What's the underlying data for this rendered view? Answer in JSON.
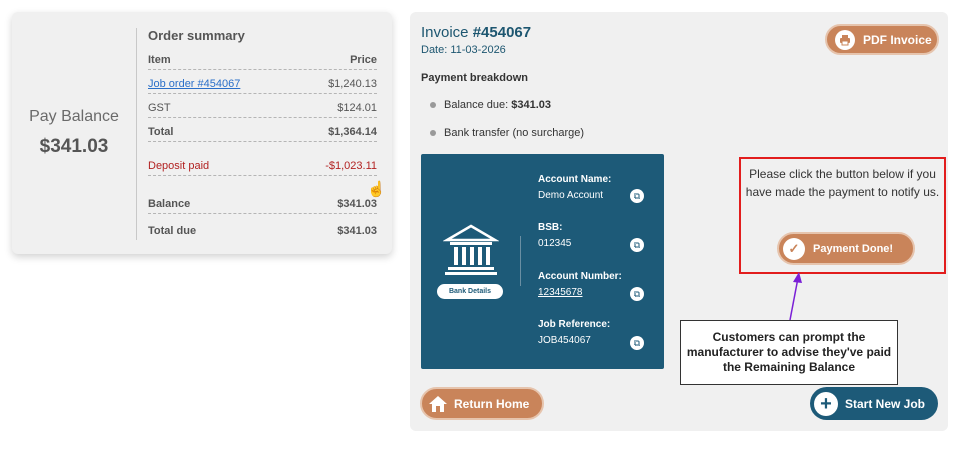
{
  "pay_balance": {
    "label": "Pay Balance",
    "amount": "$341.03"
  },
  "order_summary": {
    "title": "Order summary",
    "col_item": "Item",
    "col_price": "Price",
    "rows": [
      {
        "item": "Job order #454067",
        "price": "$1,240.13"
      },
      {
        "item": "GST",
        "price": "$124.01"
      },
      {
        "item": "Total",
        "price": "$1,364.14"
      },
      {
        "item": "Deposit paid",
        "price": "-$1,023.11"
      },
      {
        "item": "Balance",
        "price": "$341.03"
      },
      {
        "item": "Total due",
        "price": "$341.03"
      }
    ]
  },
  "invoice": {
    "title_prefix": "Invoice",
    "number": "#454067",
    "date": "Date: 11-03-2026",
    "pdf_label": "PDF Invoice"
  },
  "breakdown": {
    "title": "Payment breakdown",
    "balance_label": "Balance due:",
    "balance_value": "$341.03",
    "transfer": "Bank transfer (no surcharge)"
  },
  "bank": {
    "badge": "Bank Details",
    "fields": [
      {
        "label": "Account Name:",
        "value": "Demo Account"
      },
      {
        "label": "BSB:",
        "value": "012345"
      },
      {
        "label": "Account Number:",
        "value": "12345678"
      },
      {
        "label": "Job Reference:",
        "value": "JOB454067"
      }
    ]
  },
  "notify": {
    "text": "Please click the button below if you have made the payment to notify us.",
    "button": "Payment Done!"
  },
  "callout": "Customers can prompt the manufacturer to advise they've paid the Remaining Balance",
  "buttons": {
    "return_home": "Return Home",
    "start_new_job": "Start New Job"
  },
  "colors": {
    "accent": "#c9845a",
    "brand": "#1d5a78",
    "highlight": "#e21d1d",
    "deposit": "#b22222"
  }
}
